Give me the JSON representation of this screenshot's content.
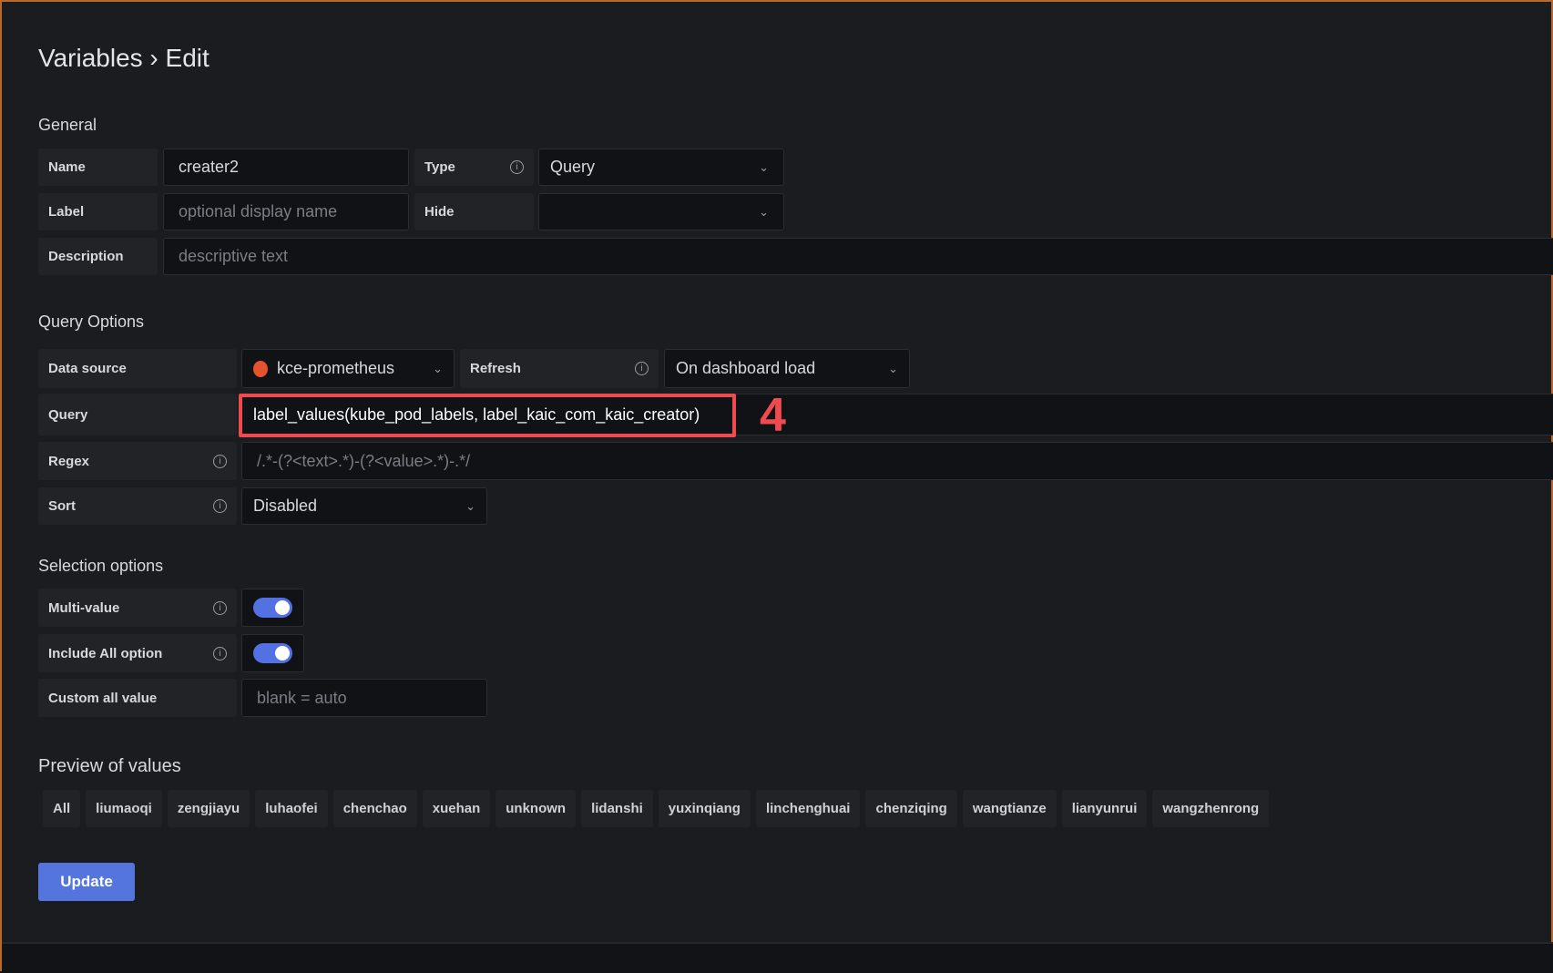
{
  "title": "Variables › Edit",
  "general": {
    "heading": "General",
    "name_label": "Name",
    "name_value": "creater2",
    "type_label": "Type",
    "type_value": "Query",
    "label_label": "Label",
    "label_placeholder": "optional display name",
    "hide_label": "Hide",
    "hide_value": "",
    "description_label": "Description",
    "description_placeholder": "descriptive text"
  },
  "query_options": {
    "heading": "Query Options",
    "datasource_label": "Data source",
    "datasource_value": "kce-prometheus",
    "refresh_label": "Refresh",
    "refresh_value": "On dashboard load",
    "query_label": "Query",
    "query_value": "label_values(kube_pod_labels, label_kaic_com_kaic_creator)",
    "regex_label": "Regex",
    "regex_placeholder": "/.*-(?<text>.*)-(?<value>.*)-.*/",
    "sort_label": "Sort",
    "sort_value": "Disabled"
  },
  "annotation": {
    "number": "4",
    "color": "#ef4a4f"
  },
  "selection": {
    "heading": "Selection options",
    "multi_label": "Multi-value",
    "multi_on": true,
    "includeall_label": "Include All option",
    "includeall_on": true,
    "custom_label": "Custom all value",
    "custom_placeholder": "blank = auto"
  },
  "preview": {
    "heading": "Preview of values",
    "values": [
      "All",
      "liumaoqi",
      "zengjiayu",
      "luhaofei",
      "chenchao",
      "xuehan",
      "unknown",
      "lidanshi",
      "yuxinqiang",
      "linchenghuai",
      "chenziqing",
      "wangtianze",
      "lianyunrui",
      "wangzhenrong"
    ]
  },
  "update_label": "Update",
  "colors": {
    "accent": "#5474de",
    "background": "#1b1c20"
  }
}
